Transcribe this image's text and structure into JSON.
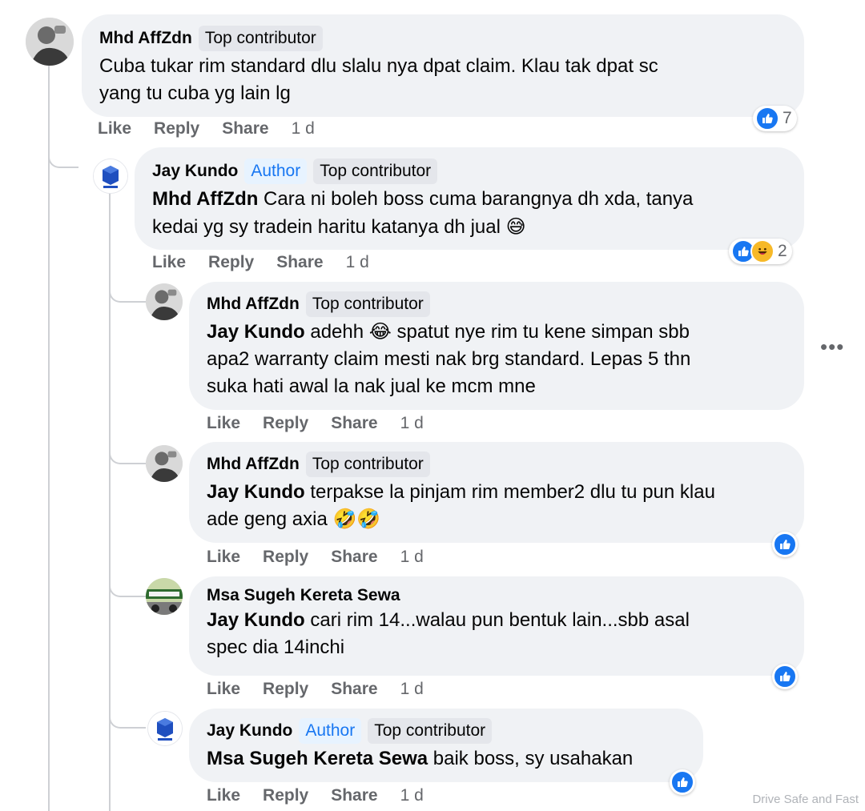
{
  "actions": {
    "like": "Like",
    "reply": "Reply",
    "share": "Share"
  },
  "comments": [
    {
      "author": "Mhd AffZdn",
      "badges": [
        "Top contributor"
      ],
      "line1": "Cuba tukar rim standard dlu slalu nya dpat claim. Klau tak dpat sc",
      "line2": "yang tu cuba yg lain lg",
      "time": "1 d",
      "reaction_count": "7"
    },
    {
      "author": "Jay Kundo",
      "badges": [
        "Author",
        "Top contributor"
      ],
      "mention": "Mhd AffZdn",
      "line1": " Cara ni boleh boss cuma barangnya dh xda, tanya",
      "line2": "kedai yg sy tradein haritu katanya dh jual",
      "emoji": "😅",
      "time": "1 d",
      "reaction_count": "2"
    },
    {
      "author": "Mhd AffZdn",
      "badges": [
        "Top contributor"
      ],
      "mention": "Jay Kundo",
      "line1": " adehh 😂 spatut nye rim tu kene simpan sbb",
      "line2": "apa2 warranty claim mesti nak brg standard. Lepas 5 thn",
      "line3": "suka hati awal la nak jual ke mcm mne",
      "time": "1 d"
    },
    {
      "author": "Mhd AffZdn",
      "badges": [
        "Top contributor"
      ],
      "mention": "Jay Kundo",
      "line1": " terpakse la pinjam rim member2 dlu tu pun klau",
      "line2": "ade geng axia 🤣🤣",
      "time": "1 d"
    },
    {
      "author": "Msa Sugeh Kereta Sewa",
      "badges": [],
      "mention": "Jay Kundo",
      "line1": " cari rim 14...walau pun bentuk lain...sbb asal",
      "line2": "spec dia 14inchi",
      "time": "1 d"
    },
    {
      "author": "Jay Kundo",
      "badges": [
        "Author",
        "Top contributor"
      ],
      "mention": "Msa Sugeh Kereta Sewa",
      "line1": " baik boss, sy usahakan",
      "time": "1 d"
    }
  ],
  "more_label": "•••",
  "watermark": "Drive Safe and Fast",
  "colors": {
    "accent": "#1877f2",
    "bubble": "#f0f2f5",
    "muted": "#65676b"
  }
}
